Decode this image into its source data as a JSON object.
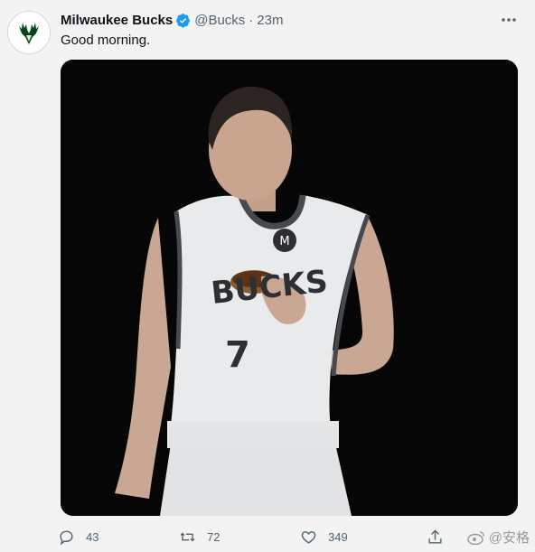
{
  "tweet": {
    "author_name": "Milwaukee Bucks",
    "handle": "@Bucks",
    "separator": "·",
    "time": "23m",
    "text": "Good morning.",
    "avatar_icon": "bucks-logo-icon",
    "verified_icon": "verified-badge-icon",
    "more_icon": "more-options-icon"
  },
  "media": {
    "jersey_text": "BUCKS",
    "jersey_number": "7",
    "chest_logo": "M"
  },
  "actions": {
    "replies": "43",
    "retweets": "72",
    "likes": "349",
    "share_icon": "share-icon"
  },
  "watermark": {
    "text": "@安格"
  },
  "colors": {
    "background": "#f3f3f3",
    "verified_blue": "#1d9bf0",
    "bucks_green": "#00471b",
    "muted_text": "#536471"
  }
}
